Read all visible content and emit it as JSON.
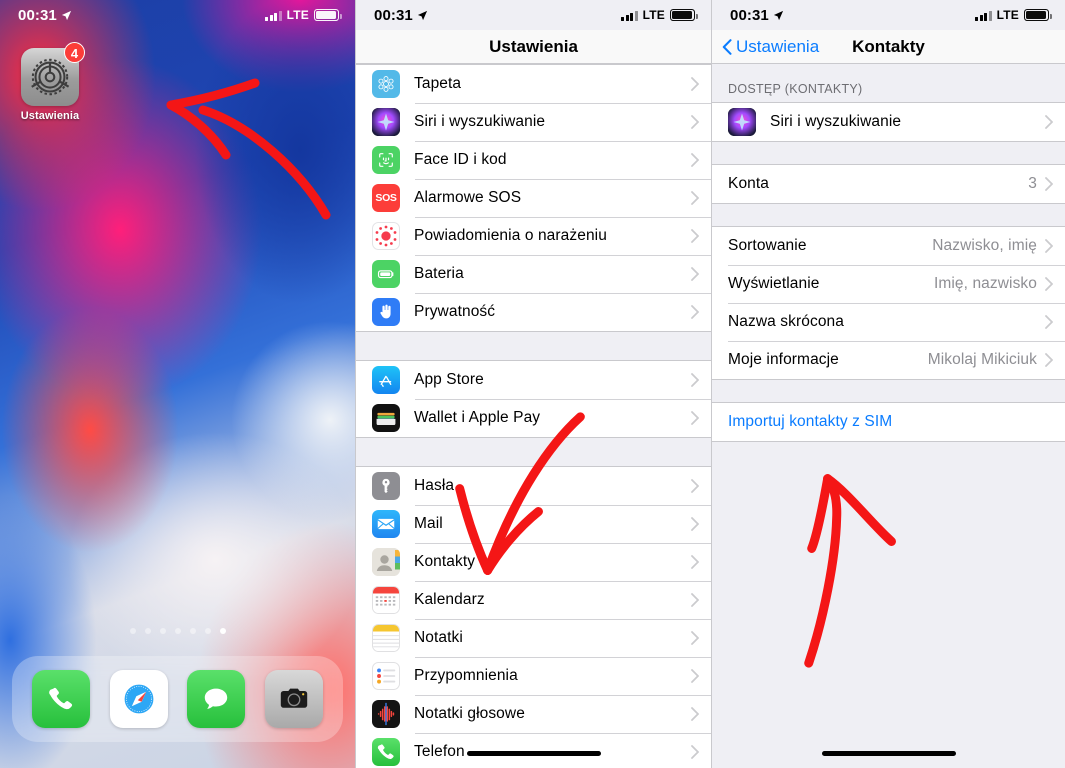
{
  "home_screen": {
    "status_bar": {
      "time": "00:31",
      "carrier_label": "LTE",
      "location_icon": "location-arrow-icon"
    },
    "apps": [
      {
        "label": "Ustawienia",
        "badge": "4",
        "icon": "settings-gear-icon"
      }
    ],
    "page_dots": {
      "count": 7,
      "active_index": 6
    },
    "dock": [
      {
        "label": "Telefon",
        "icon": "phone-icon"
      },
      {
        "label": "Safari",
        "icon": "safari-compass-icon"
      },
      {
        "label": "Wiadomości",
        "icon": "messages-bubble-icon"
      },
      {
        "label": "Aparat",
        "icon": "camera-icon"
      }
    ],
    "annotation": {
      "type": "red-arrow",
      "points_to": "Ustawienia"
    }
  },
  "settings_screen": {
    "status_bar": {
      "time": "00:31",
      "carrier_label": "LTE",
      "location_icon": "location-arrow-icon"
    },
    "title": "Ustawienia",
    "groups": [
      {
        "rows": [
          {
            "label": "Tapeta",
            "icon": "wallpaper-icon",
            "accessory": "chevron"
          },
          {
            "label": "Siri i wyszukiwanie",
            "icon": "siri-icon",
            "accessory": "chevron"
          },
          {
            "label": "Face ID i kod",
            "icon": "faceid-icon",
            "accessory": "chevron"
          },
          {
            "label": "Alarmowe SOS",
            "icon": "sos-icon",
            "accessory": "chevron"
          },
          {
            "label": "Powiadomienia o narażeniu",
            "icon": "exposure-notification-icon",
            "accessory": "chevron"
          },
          {
            "label": "Bateria",
            "icon": "battery-icon",
            "accessory": "chevron"
          },
          {
            "label": "Prywatność",
            "icon": "privacy-hand-icon",
            "accessory": "chevron"
          }
        ]
      },
      {
        "rows": [
          {
            "label": "App Store",
            "icon": "app-store-icon",
            "accessory": "chevron"
          },
          {
            "label": "Wallet i Apple Pay",
            "icon": "wallet-icon",
            "accessory": "chevron"
          }
        ]
      },
      {
        "rows": [
          {
            "label": "Hasła",
            "icon": "passwords-key-icon",
            "accessory": "chevron"
          },
          {
            "label": "Mail",
            "icon": "mail-envelope-icon",
            "accessory": "chevron"
          },
          {
            "label": "Kontakty",
            "icon": "contacts-icon",
            "accessory": "chevron"
          },
          {
            "label": "Kalendarz",
            "icon": "calendar-icon",
            "accessory": "chevron"
          },
          {
            "label": "Notatki",
            "icon": "notes-icon",
            "accessory": "chevron"
          },
          {
            "label": "Przypomnienia",
            "icon": "reminders-icon",
            "accessory": "chevron"
          },
          {
            "label": "Notatki głosowe",
            "icon": "voice-memos-icon",
            "accessory": "chevron"
          },
          {
            "label": "Telefon",
            "icon": "phone-icon",
            "accessory": "chevron"
          }
        ]
      }
    ],
    "annotation": {
      "type": "red-arrow",
      "points_to": "Kontakty"
    }
  },
  "contacts_screen": {
    "status_bar": {
      "time": "00:31",
      "carrier_label": "LTE",
      "location_icon": "location-arrow-icon"
    },
    "back_label": "Ustawienia",
    "title": "Kontakty",
    "section_header": "DOSTĘP (KONTAKTY)",
    "access_rows": [
      {
        "label": "Siri i wyszukiwanie",
        "icon": "siri-icon",
        "value": "",
        "accessory": "chevron"
      }
    ],
    "accounts_rows": [
      {
        "label": "Konta",
        "value": "3",
        "accessory": "chevron"
      }
    ],
    "options_rows": [
      {
        "label": "Sortowanie",
        "value": "Nazwisko, imię",
        "accessory": "chevron"
      },
      {
        "label": "Wyświetlanie",
        "value": "Imię, nazwisko",
        "accessory": "chevron"
      },
      {
        "label": "Nazwa skrócona",
        "value": "",
        "accessory": "chevron"
      },
      {
        "label": "Moje informacje",
        "value": "Mikolaj Mikiciuk",
        "accessory": "chevron"
      }
    ],
    "action_rows": [
      {
        "label": "Importuj kontakty z SIM",
        "style": "link"
      }
    ],
    "annotation": {
      "type": "red-arrow",
      "points_to": "Importuj kontakty z SIM"
    }
  },
  "theme": {
    "accent_blue": "#0a7cff",
    "annotation_red": "#f41616",
    "list_bg": "#efeff4",
    "row_bg": "#ffffff",
    "separator": "#d2d2d6",
    "secondary_text": "#8e8e93"
  }
}
